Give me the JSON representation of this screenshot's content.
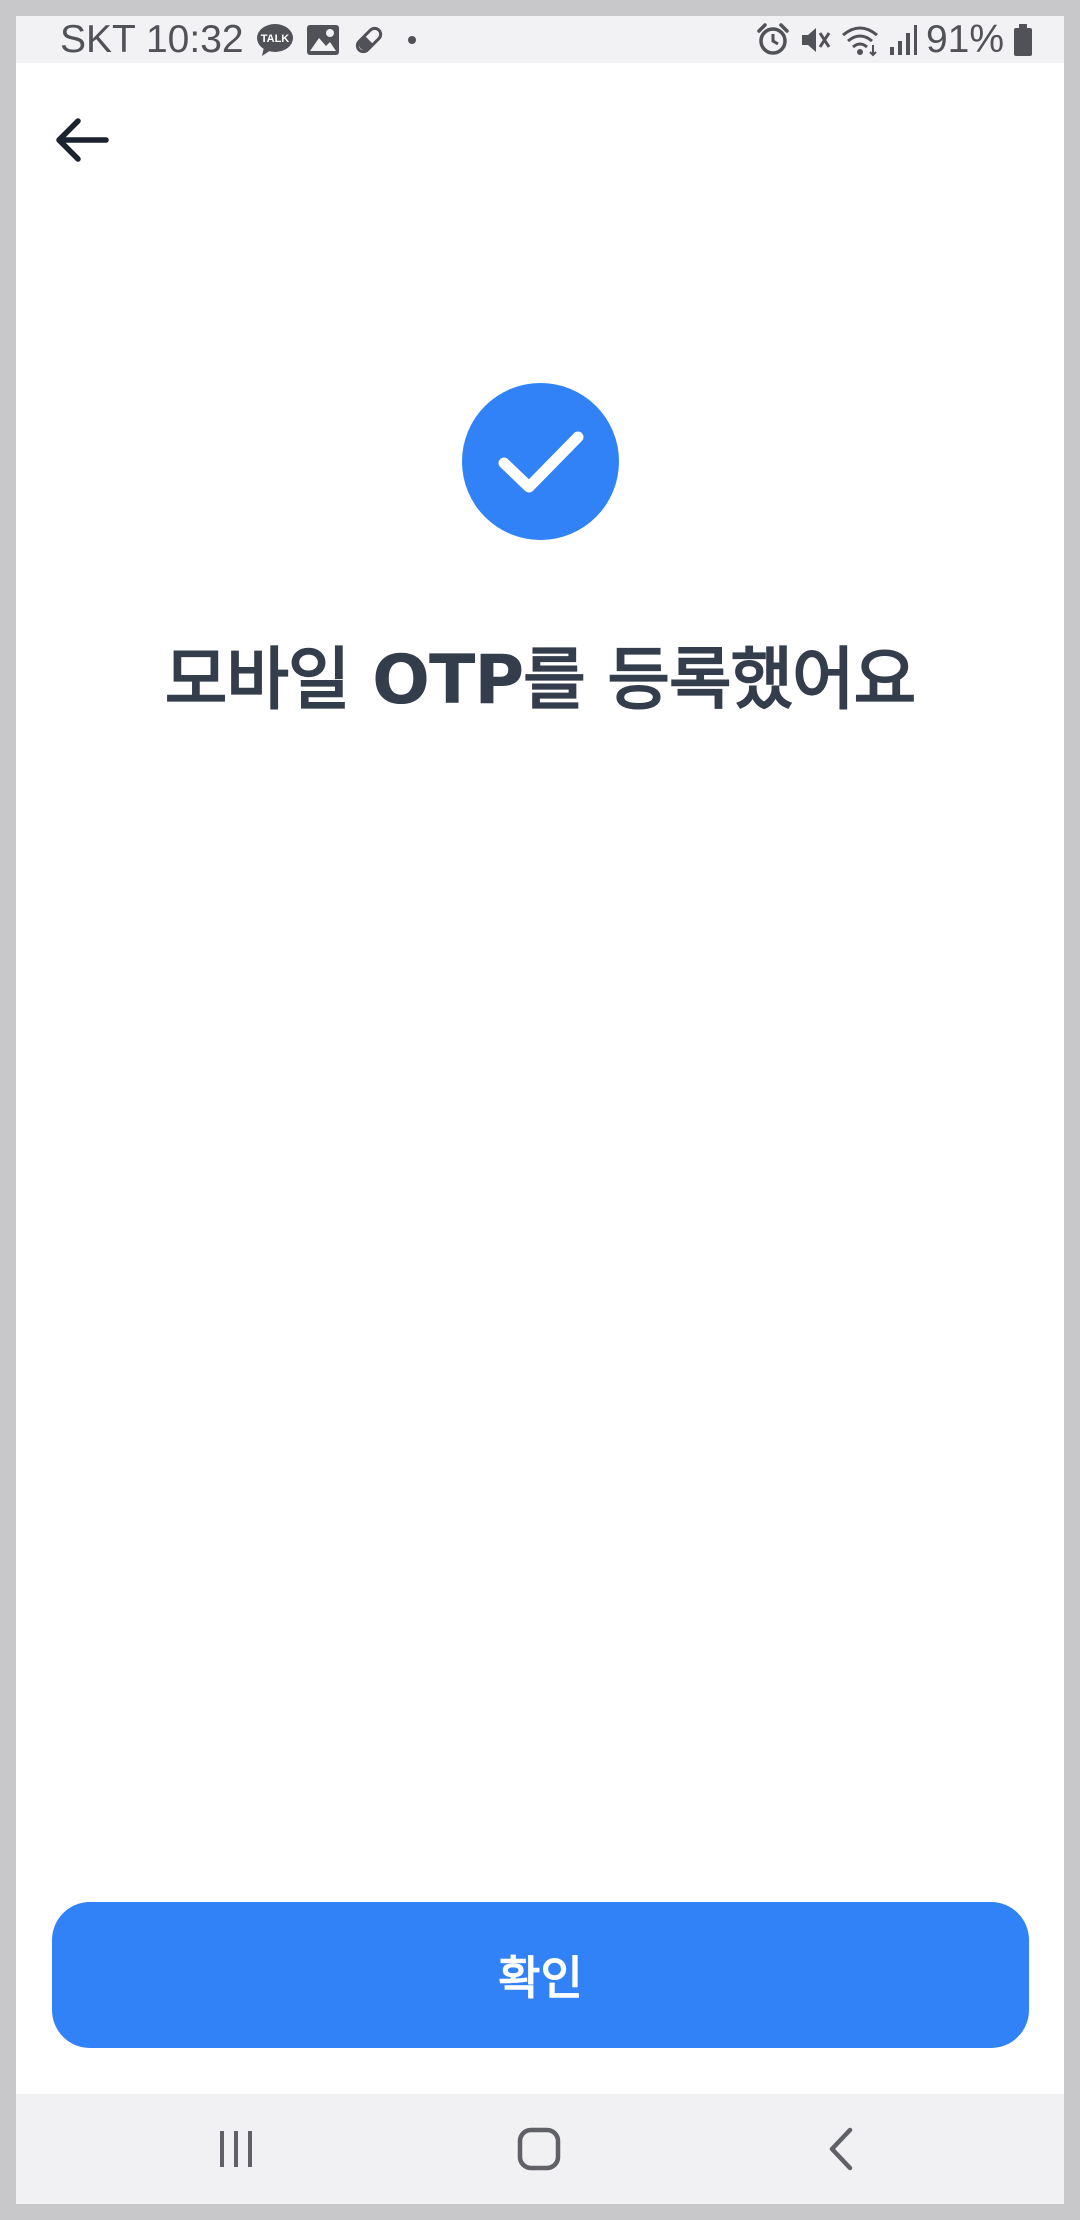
{
  "status_bar": {
    "carrier_time": "SKT 10:32",
    "battery_percent": "91%",
    "left_icons": [
      "kakaotalk-icon",
      "gallery-icon",
      "pill-icon",
      "dot-icon"
    ],
    "right_icons": [
      "alarm-icon",
      "mute-icon",
      "wifi-icon",
      "signal-icon",
      "battery-icon"
    ],
    "talk_badge": "TALK"
  },
  "header": {
    "back_icon": "arrow-left-icon"
  },
  "main": {
    "success_icon": "check-circle-icon",
    "title": "모바일 OTP를 등록했어요"
  },
  "footer": {
    "confirm_label": "확인"
  },
  "system_nav": {
    "items": [
      "recents-icon",
      "home-icon",
      "back-icon"
    ]
  },
  "colors": {
    "accent": "#3182f6",
    "title_text": "#333d4b",
    "background": "#ffffff",
    "status_bar_bg": "#f2f2f4",
    "nav_bar_bg": "#f1f1f3"
  }
}
